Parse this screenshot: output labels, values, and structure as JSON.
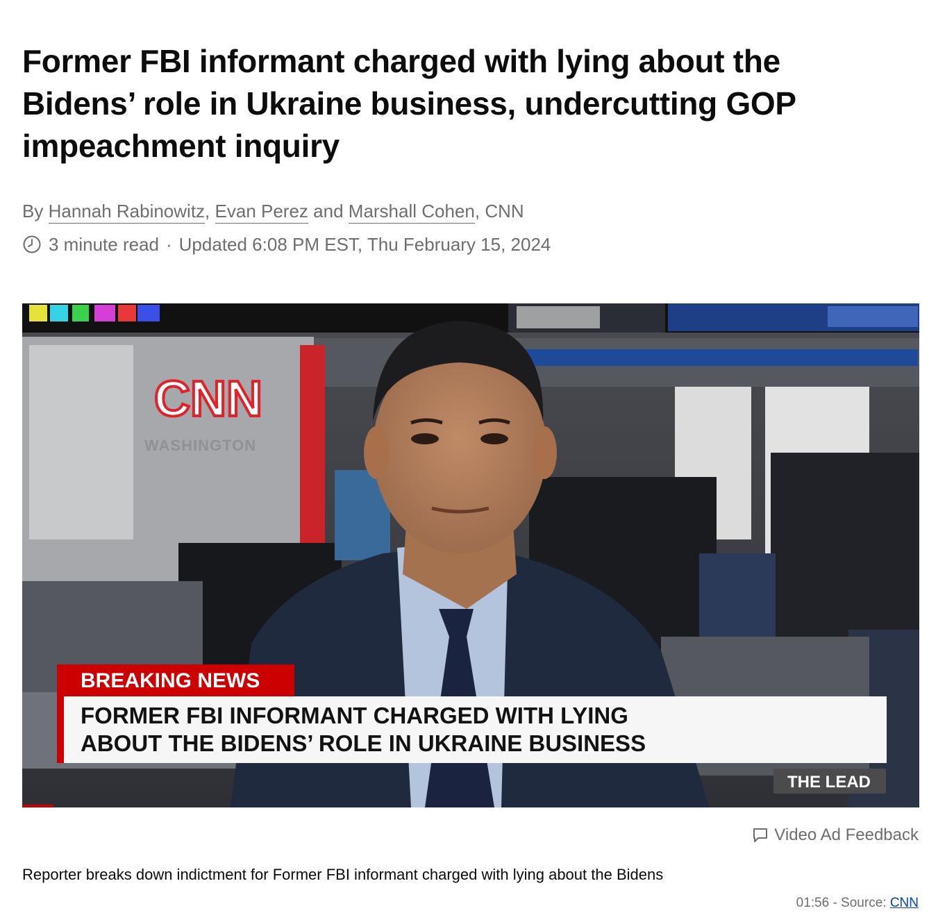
{
  "article": {
    "headline": "Former FBI informant charged with lying about the Bidens’ role in Ukraine business, undercutting GOP impeachment inquiry",
    "by_prefix": "By",
    "authors": [
      "Hannah Rabinowitz",
      "Evan Perez",
      "Marshall Cohen"
    ],
    "comma": ",",
    "and": "and",
    "outlet_suffix": ", CNN",
    "read_time": "3 minute read",
    "separator": "·",
    "updated": "Updated 6:08 PM EST, Thu February 15, 2024"
  },
  "video": {
    "logo": "CNN",
    "logo_sub": "WASHINGTON",
    "lower_third_tag": "BREAKING NEWS",
    "lower_third_line1": "FORMER FBI INFORMANT CHARGED WITH LYING",
    "lower_third_line2": "ABOUT THE BIDENS’ ROLE IN UKRAINE BUSINESS",
    "show_bug": "THE LEAD",
    "progress": 0.035
  },
  "feedback_label": "Video Ad Feedback",
  "caption": "Reporter breaks down indictment for Former FBI informant charged with lying about the Bidens",
  "duration": "01:56",
  "source_prefix": " - Source: ",
  "source_link": "CNN"
}
